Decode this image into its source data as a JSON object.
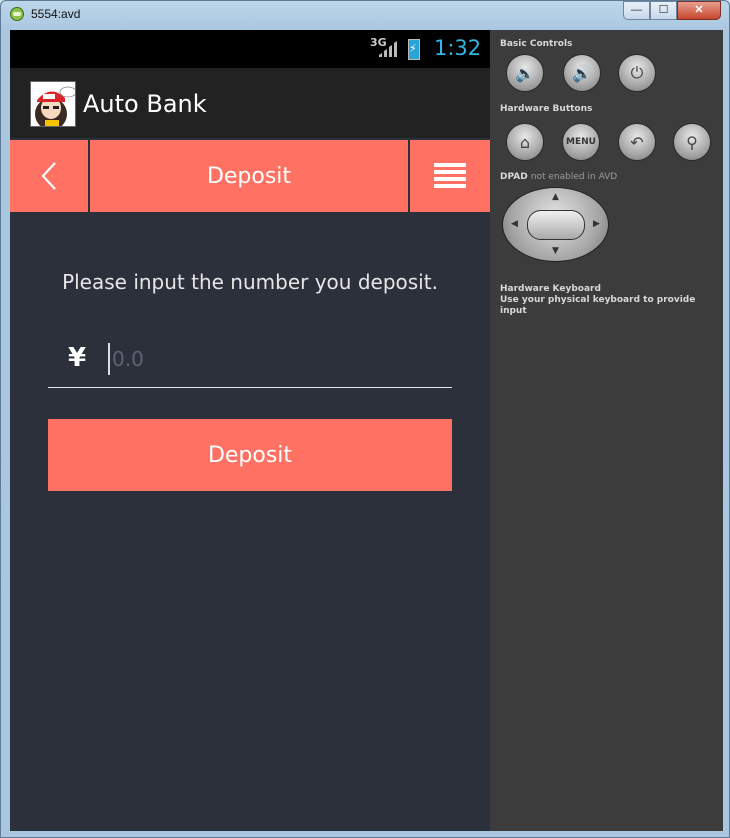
{
  "window": {
    "title": "5554:avd",
    "minimize": "—",
    "maximize": "☐",
    "close": "✕"
  },
  "statusbar": {
    "network": "3G",
    "time": "1:32"
  },
  "actionbar": {
    "app_title": "Auto Bank"
  },
  "navbar": {
    "back_icon": "chevron-left-icon",
    "title": "Deposit",
    "menu_icon": "menu-lines-icon"
  },
  "form": {
    "prompt": "Please input the number you deposit.",
    "currency_symbol": "¥",
    "amount_placeholder": "0.0",
    "amount_value": ""
  },
  "deposit_button": {
    "label": "Deposit"
  },
  "emulator_panel": {
    "basic_controls_title": "Basic Controls",
    "hardware_buttons_title": "Hardware Buttons",
    "menu_label": "MENU",
    "dpad_title": "DPAD",
    "dpad_note": "not enabled in AVD",
    "keyboard_title": "Hardware Keyboard",
    "keyboard_note": "Use your physical keyboard to provide input"
  },
  "colors": {
    "accent": "#ff7263",
    "background": "#2b303b",
    "status_clock": "#33b5e5"
  }
}
